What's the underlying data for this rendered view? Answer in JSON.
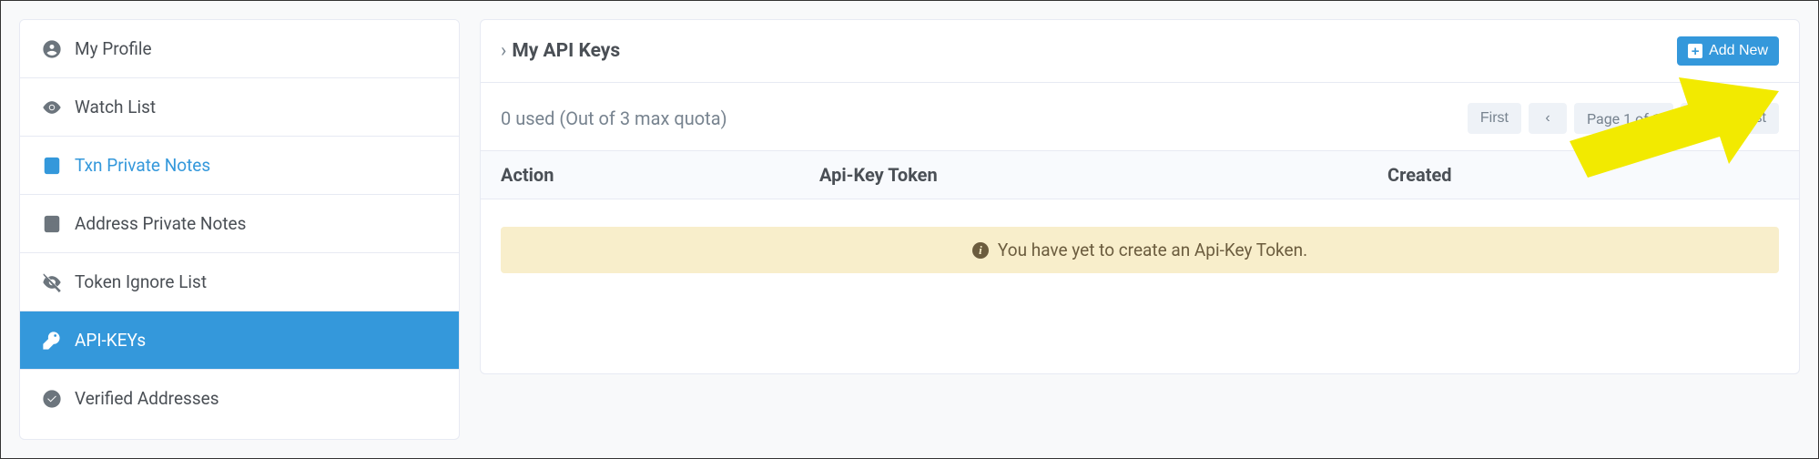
{
  "sidebar": {
    "items": [
      {
        "label": "My Profile"
      },
      {
        "label": "Watch List"
      },
      {
        "label": "Txn Private Notes"
      },
      {
        "label": "Address Private Notes"
      },
      {
        "label": "Token Ignore List"
      },
      {
        "label": "API-KEYs"
      },
      {
        "label": "Verified Addresses"
      }
    ]
  },
  "main": {
    "title": "My API Keys",
    "add_label": "Add New",
    "quota_text": "0 used (Out of 3 max quota)",
    "pager": {
      "first": "First",
      "prev": "‹",
      "page_label": "Page 1 of 1",
      "next": "›",
      "last": "Last"
    },
    "columns": {
      "action": "Action",
      "token": "Api-Key Token",
      "created": "Created"
    },
    "alert_text": "You have yet to create an Api-Key Token."
  }
}
